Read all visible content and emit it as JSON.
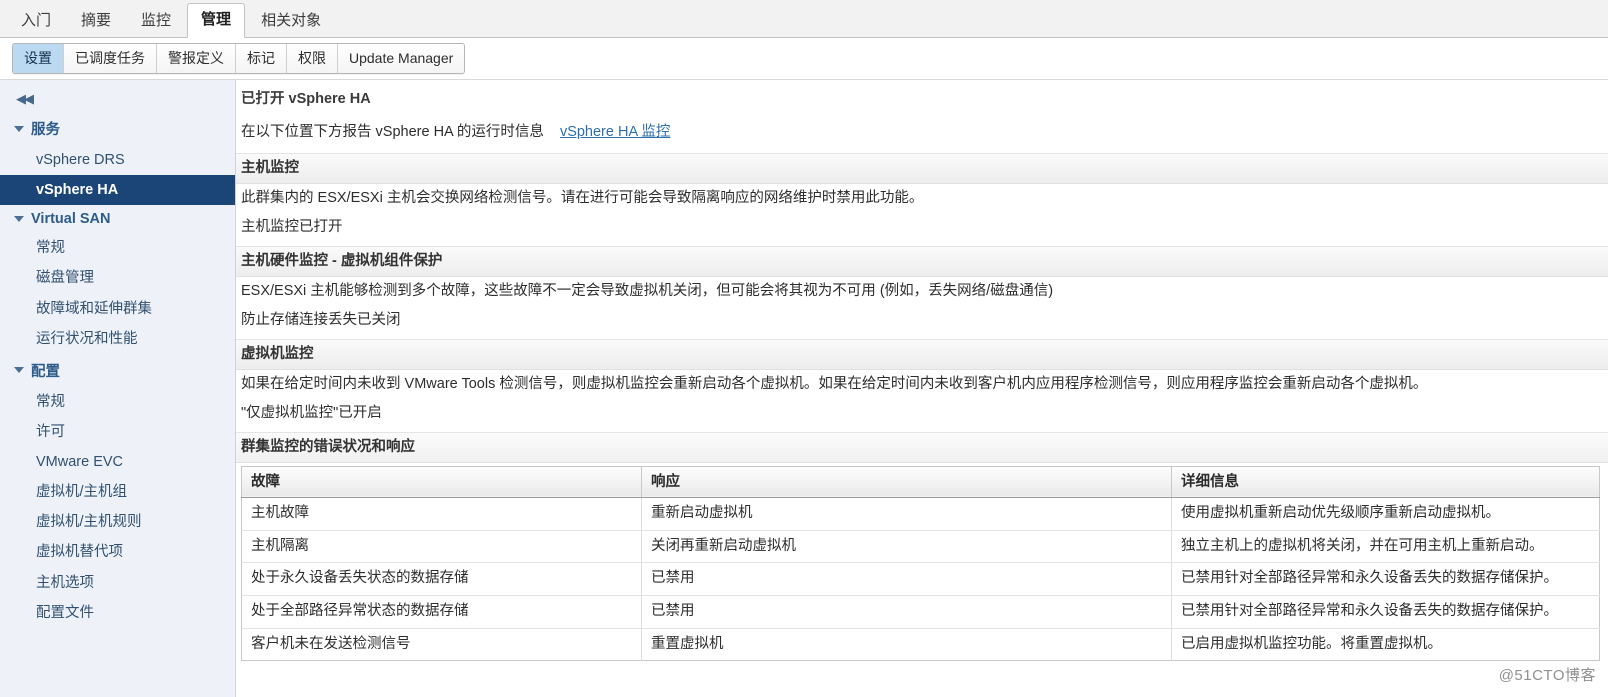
{
  "top_tabs": [
    {
      "label": "入门",
      "active": false
    },
    {
      "label": "摘要",
      "active": false
    },
    {
      "label": "监控",
      "active": false
    },
    {
      "label": "管理",
      "active": true
    },
    {
      "label": "相关对象",
      "active": false
    }
  ],
  "sub_tabs": [
    {
      "label": "设置",
      "active": true
    },
    {
      "label": "已调度任务",
      "active": false
    },
    {
      "label": "警报定义",
      "active": false
    },
    {
      "label": "标记",
      "active": false
    },
    {
      "label": "权限",
      "active": false
    },
    {
      "label": "Update Manager",
      "active": false
    }
  ],
  "sidebar": {
    "collapse_icon": "◀◀",
    "groups": [
      {
        "label": "服务",
        "items": [
          {
            "label": "vSphere DRS",
            "selected": false
          },
          {
            "label": "vSphere HA",
            "selected": true
          }
        ]
      },
      {
        "label": "Virtual SAN",
        "items": [
          {
            "label": "常规",
            "selected": false
          },
          {
            "label": "磁盘管理",
            "selected": false
          },
          {
            "label": "故障域和延伸群集",
            "selected": false
          },
          {
            "label": "运行状况和性能",
            "selected": false
          }
        ]
      },
      {
        "label": "配置",
        "items": [
          {
            "label": "常规",
            "selected": false
          },
          {
            "label": "许可",
            "selected": false
          },
          {
            "label": "VMware EVC",
            "selected": false
          },
          {
            "label": "虚拟机/主机组",
            "selected": false
          },
          {
            "label": "虚拟机/主机规则",
            "selected": false
          },
          {
            "label": "虚拟机替代项",
            "selected": false
          },
          {
            "label": "主机选项",
            "selected": false
          },
          {
            "label": "配置文件",
            "selected": false
          }
        ]
      }
    ]
  },
  "main": {
    "ha_status_title": "已打开 vSphere HA",
    "runtime_info_text": "在以下位置下方报告 vSphere HA 的运行时信息",
    "runtime_info_link": "vSphere HA 监控",
    "host_monitoring": {
      "heading": "主机监控",
      "description": "此群集内的 ESX/ESXi 主机会交换网络检测信号。请在进行可能会导致隔离响应的网络维护时禁用此功能。",
      "status": "主机监控已打开"
    },
    "hardware_monitoring": {
      "heading": "主机硬件监控 - 虚拟机组件保护",
      "description": "ESX/ESXi 主机能够检测到多个故障，这些故障不一定会导致虚拟机关闭，但可能会将其视为不可用 (例如，丢失网络/磁盘通信)",
      "status": "防止存储连接丢失已关闭"
    },
    "vm_monitoring": {
      "heading": "虚拟机监控",
      "description": "如果在给定时间内未收到 VMware Tools 检测信号，则虚拟机监控会重新启动各个虚拟机。如果在给定时间内未收到客户机内应用程序检测信号，则应用程序监控会重新启动各个虚拟机。",
      "status": "\"仅虚拟机监控\"已开启"
    },
    "failure_table": {
      "heading": "群集监控的错误状况和响应",
      "columns": [
        "故障",
        "响应",
        "详细信息"
      ],
      "rows": [
        [
          "主机故障",
          "重新启动虚拟机",
          "使用虚拟机重新启动优先级顺序重新启动虚拟机。"
        ],
        [
          "主机隔离",
          "关闭再重新启动虚拟机",
          "独立主机上的虚拟机将关闭，并在可用主机上重新启动。"
        ],
        [
          "处于永久设备丢失状态的数据存储",
          "已禁用",
          "已禁用针对全部路径异常和永久设备丢失的数据存储保护。"
        ],
        [
          "处于全部路径异常状态的数据存储",
          "已禁用",
          "已禁用针对全部路径异常和永久设备丢失的数据存储保护。"
        ],
        [
          "客户机未在发送检测信号",
          "重置虚拟机",
          "已启用虚拟机监控功能。将重置虚拟机。"
        ]
      ]
    }
  },
  "watermark": "@51CTO博客"
}
